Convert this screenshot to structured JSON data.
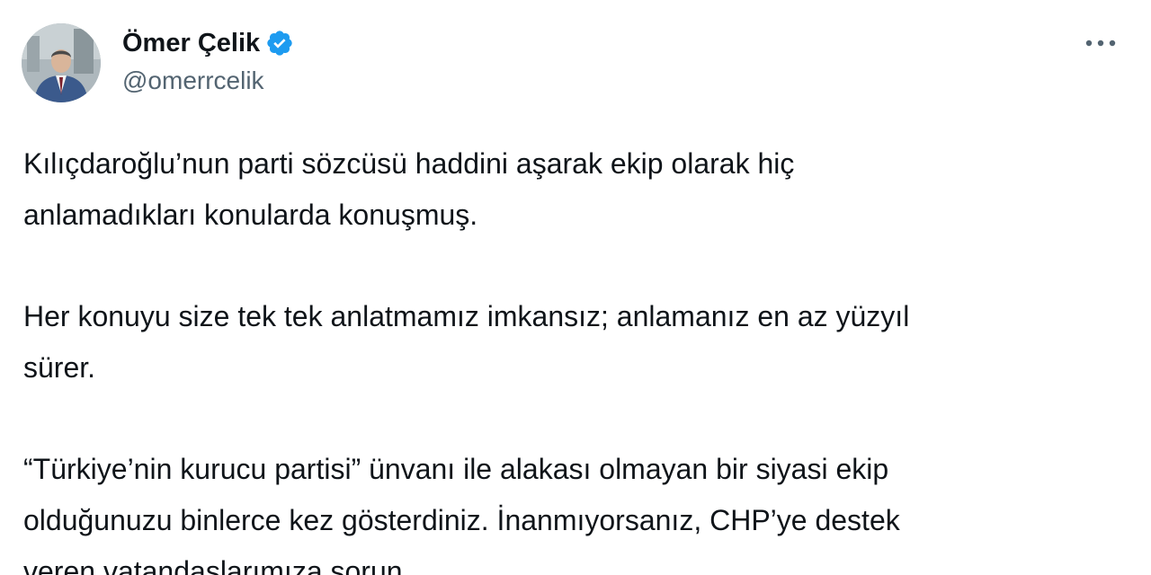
{
  "author": {
    "name": "Ömer Çelik",
    "handle": "@omerrcelik",
    "avatar_icon": "profile-photo",
    "verified_icon": "verified-badge-icon",
    "verified_color": "#1d9bf0"
  },
  "menu": {
    "icon": "more-options-icon"
  },
  "tweet": {
    "paragraphs": [
      "Kılıçdaroğlu’nun parti sözcüsü haddini aşarak ekip olarak hiç\nanlamadıkları konularda konuşmuş.",
      "Her konuyu size tek tek anlatmamız imkansız; anlamanız en az yüzyıl\nsürer.",
      "“Türkiye’nin kurucu partisi” ünvanı ile alakası olmayan bir siyasi ekip\nolduğunuzu binlerce kez gösterdiniz. İnanmıyorsanız, CHP’ye destek\nveren vatandaşlarımıza sorun..."
    ]
  },
  "colors": {
    "text": "#0f1419",
    "secondary": "#536471",
    "background": "#ffffff"
  }
}
